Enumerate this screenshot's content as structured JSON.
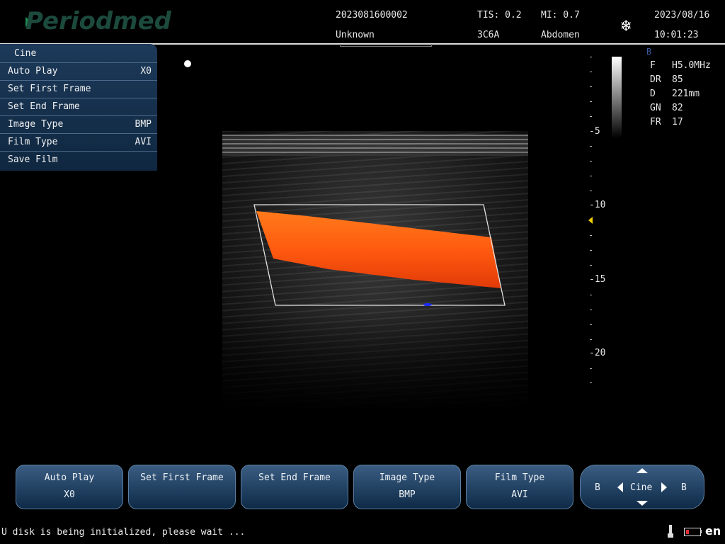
{
  "header": {
    "logo": "Periodmed",
    "patient_id": "2023081600002",
    "patient_name": "Unknown",
    "tis": "TIS: 0.2",
    "probe": "3C6A",
    "mi": "MI: 0.7",
    "exam": "Abdomen",
    "date": "2023/08/16",
    "time": "10:01:23",
    "freeze_icon": "snowflake-icon"
  },
  "cine_menu": {
    "title": "Cine",
    "items": [
      {
        "label": "Auto Play",
        "value": "X0"
      },
      {
        "label": "Set First Frame",
        "value": ""
      },
      {
        "label": "Set End Frame",
        "value": ""
      },
      {
        "label": "Image Type",
        "value": "BMP"
      },
      {
        "label": "Film Type",
        "value": "AVI"
      },
      {
        "label": "Save Film",
        "value": ""
      }
    ]
  },
  "depth_scale": {
    "labels": [
      "-5",
      "-10",
      "-15",
      "-20"
    ]
  },
  "params": {
    "mode": "B",
    "rows": [
      {
        "key": "F",
        "value": "H5.0MHz"
      },
      {
        "key": "DR",
        "value": "85"
      },
      {
        "key": "D",
        "value": "221mm"
      },
      {
        "key": "GN",
        "value": "82"
      },
      {
        "key": "FR",
        "value": "17"
      }
    ]
  },
  "softkeys": [
    {
      "line1": "Auto Play",
      "line2": "X0"
    },
    {
      "line1": "Set First Frame",
      "line2": ""
    },
    {
      "line1": "Set End Frame",
      "line2": ""
    },
    {
      "line1": "Image Type",
      "line2": "BMP"
    },
    {
      "line1": "Film Type",
      "line2": "AVI"
    }
  ],
  "cine_nav": {
    "left": "B",
    "center": "Cine",
    "right": "B"
  },
  "status": {
    "message": "U disk is being initialized, please wait ...",
    "language": "en"
  },
  "colors": {
    "panel": "#1d3a5a",
    "doppler": "#ff5a14",
    "roi": "#e0e0e0"
  }
}
